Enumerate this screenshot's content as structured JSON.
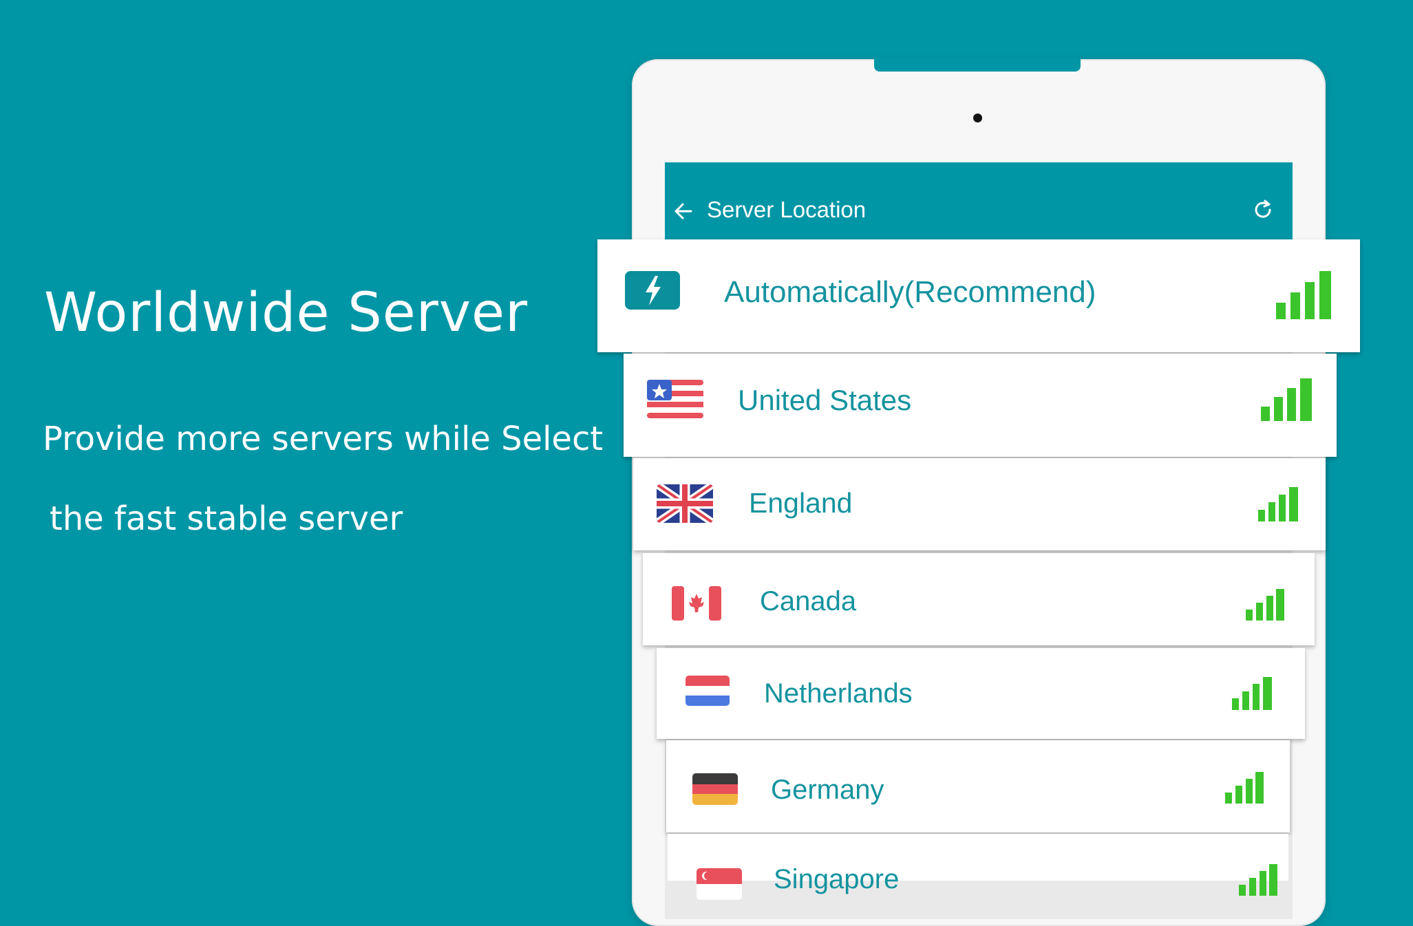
{
  "promo": {
    "headline": "Worldwide Server",
    "sub_line1": "Provide more servers while Select",
    "sub_line2": "the fast stable server"
  },
  "app": {
    "title": "Server Location",
    "back_icon": "arrow-left-icon",
    "refresh_icon": "refresh-icon"
  },
  "servers": [
    {
      "name": "Automatically(Recommend)",
      "icon": "lightning-bolt-icon",
      "signal_bars": 4
    },
    {
      "name": "United States",
      "icon": "flag-united-states-icon",
      "signal_bars": 4
    },
    {
      "name": "England",
      "icon": "flag-united-kingdom-icon",
      "signal_bars": 4
    },
    {
      "name": "Canada",
      "icon": "flag-canada-icon",
      "signal_bars": 4
    },
    {
      "name": "Netherlands",
      "icon": "flag-netherlands-icon",
      "signal_bars": 4
    },
    {
      "name": "Germany",
      "icon": "flag-germany-icon",
      "signal_bars": 4
    },
    {
      "name": "Singapore",
      "icon": "flag-singapore-icon",
      "signal_bars": 4
    }
  ],
  "colors": {
    "background": "#0196a6",
    "label": "#14939f",
    "signal": "#3cc42c"
  }
}
